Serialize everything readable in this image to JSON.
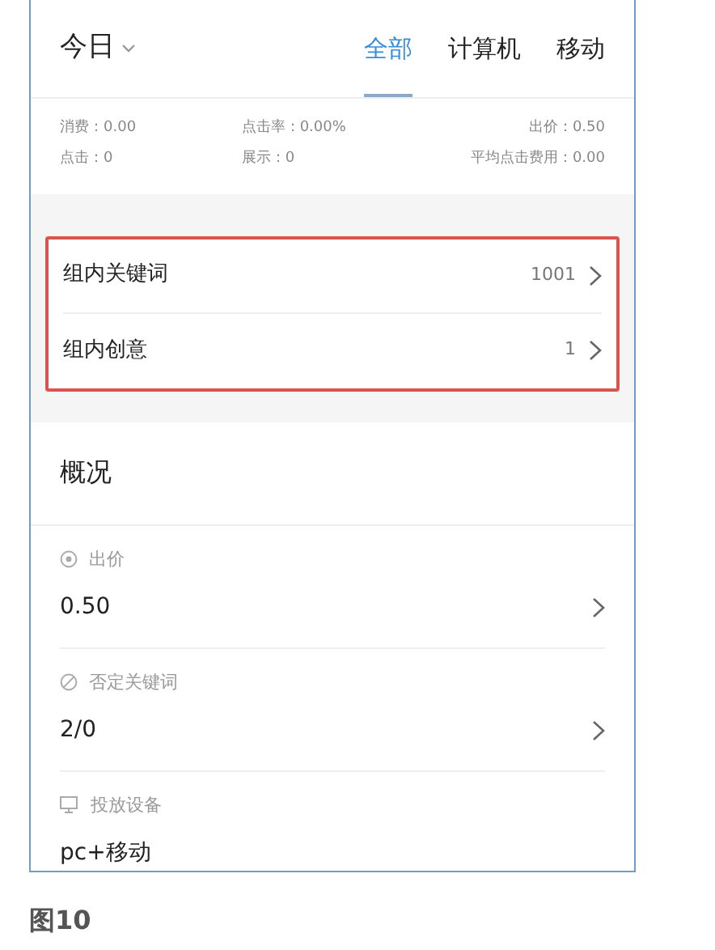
{
  "header": {
    "period": "今日",
    "tabs": [
      {
        "label": "全部",
        "selected": true
      },
      {
        "label": "计算机",
        "selected": false
      },
      {
        "label": "移动",
        "selected": false
      }
    ]
  },
  "stats": [
    {
      "label": "消费：0.00"
    },
    {
      "label": "点击率：0.00%"
    },
    {
      "label": "出价：0.50"
    },
    {
      "label": "点击：0"
    },
    {
      "label": "展示：0"
    },
    {
      "label": "平均点击费用：0.00"
    }
  ],
  "group_links": {
    "highlighted": true,
    "items": [
      {
        "label": "组内关键词",
        "count": "1001"
      },
      {
        "label": "组内创意",
        "count": "1"
      }
    ]
  },
  "overview": {
    "title": "概况",
    "items": [
      {
        "kind": "bid",
        "label": "出价",
        "value": "0.50",
        "chevron": true
      },
      {
        "kind": "negative",
        "label": "否定关键词",
        "value": "2/0",
        "chevron": true
      },
      {
        "kind": "device",
        "label": "投放设备",
        "value": "pc+移动",
        "chevron": false
      }
    ]
  },
  "caption": "图10"
}
